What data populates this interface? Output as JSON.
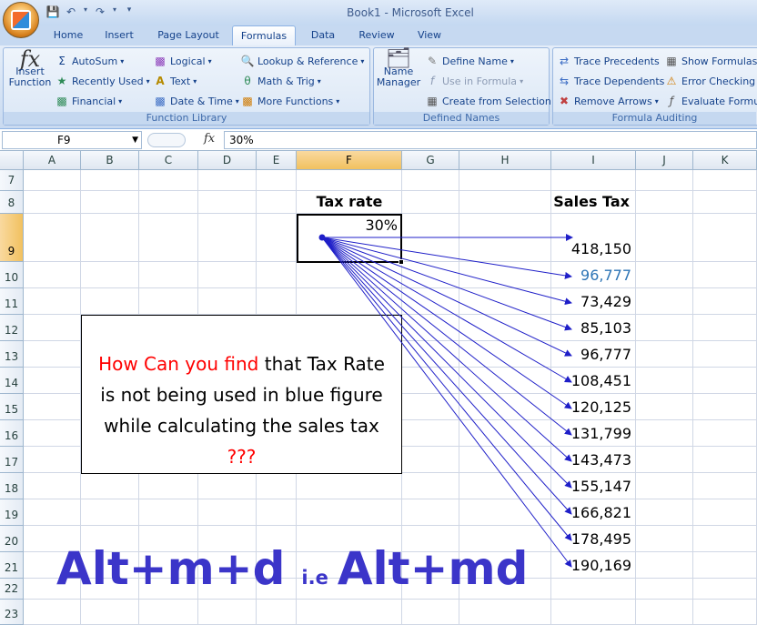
{
  "window": {
    "title": "Book1 - Microsoft Excel"
  },
  "quick_access": {
    "save_icon": "save-icon",
    "undo_icon": "undo-icon",
    "redo_icon": "redo-icon",
    "customize_icon": "customize-qat-icon"
  },
  "tabs": [
    {
      "label": "Home",
      "active": false
    },
    {
      "label": "Insert",
      "active": false
    },
    {
      "label": "Page Layout",
      "active": false
    },
    {
      "label": "Formulas",
      "active": true
    },
    {
      "label": "Data",
      "active": false
    },
    {
      "label": "Review",
      "active": false
    },
    {
      "label": "View",
      "active": false
    }
  ],
  "ribbon": {
    "function_library": {
      "label": "Function Library",
      "insert_function": "Insert Function",
      "insert_function_line1": "Insert",
      "insert_function_line2": "Function",
      "autosum": "AutoSum",
      "recently_used": "Recently Used",
      "financial": "Financial",
      "logical": "Logical",
      "text": "Text",
      "date_time": "Date & Time",
      "lookup_reference": "Lookup & Reference",
      "math_trig": "Math & Trig",
      "more_functions": "More Functions"
    },
    "defined_names": {
      "label": "Defined Names",
      "name_manager_line1": "Name",
      "name_manager_line2": "Manager",
      "define_name": "Define Name",
      "use_in_formula": "Use in Formula",
      "create_from_selection": "Create from Selection"
    },
    "formula_auditing": {
      "label": "Formula Auditing",
      "trace_precedents": "Trace Precedents",
      "trace_dependents": "Trace Dependents",
      "remove_arrows": "Remove Arrows",
      "show_formulas": "Show Formulas",
      "error_checking": "Error Checking",
      "evaluate_formula": "Evaluate Formula"
    }
  },
  "formula_bar": {
    "name_box": "F9",
    "fx_label": "fx",
    "content": "30%"
  },
  "columns": [
    "A",
    "B",
    "C",
    "D",
    "E",
    "F",
    "G",
    "H",
    "I",
    "J",
    "K"
  ],
  "selected_column": "F",
  "rows": [
    "7",
    "8",
    "9",
    "10",
    "11",
    "12",
    "13",
    "14",
    "15",
    "16",
    "17",
    "18",
    "19",
    "20",
    "21",
    "22",
    "23"
  ],
  "selected_row": "9",
  "cells": {
    "tax_rate_header": "Tax rate",
    "tax_rate_value": "30%",
    "sales_tax_header": "Sales Tax",
    "sales_tax_values": [
      "418,150",
      "96,777",
      "73,429",
      "85,103",
      "96,777",
      "108,451",
      "120,125",
      "131,799",
      "143,473",
      "155,147",
      "166,821",
      "178,495",
      "190,169"
    ],
    "highlight_color": "#2e75b6"
  },
  "callout": {
    "line1_red": "How Can you find",
    "line1_black": " that Tax Rate",
    "line2": "is not being used in blue figure",
    "line3": "while calculating the sales tax",
    "line4_red": "???"
  },
  "shortcut": {
    "primary": "Alt+m+d",
    "ie": "i.e",
    "secondary": "Alt+md",
    "color": "#3b35c9"
  },
  "arrow_color": "#1f1fc8"
}
